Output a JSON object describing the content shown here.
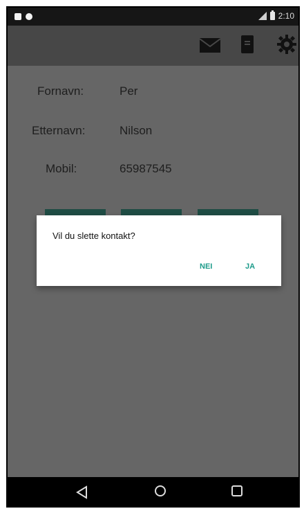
{
  "status_bar": {
    "time": "2:10",
    "icons": [
      "notification-square-icon",
      "notification-dot-icon",
      "signal-icon",
      "battery-icon"
    ]
  },
  "toolbar": {
    "icons": [
      "mail-icon",
      "contact-book-icon",
      "settings-gear-icon"
    ]
  },
  "contact": {
    "first_name_label": "Fornavn:",
    "first_name_value": "Per",
    "last_name_label": "Etternavn:",
    "last_name_value": "Nilson",
    "mobile_label": "Mobil:",
    "mobile_value": "65987545"
  },
  "dialog": {
    "message": "Vil du slette kontakt?",
    "no_button": "NEI",
    "yes_button": "JA"
  },
  "colors": {
    "accent": "#1c9b8a",
    "toolbar": "#474747",
    "background": "#666666"
  }
}
